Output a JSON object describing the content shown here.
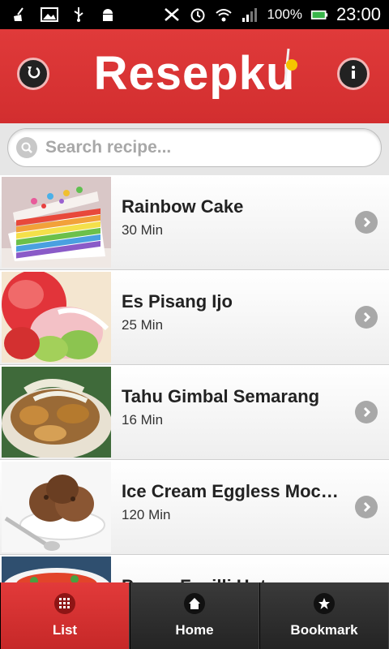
{
  "status_bar": {
    "battery": "100%",
    "time": "23:00",
    "icons": [
      "broom-icon",
      "image-icon",
      "usb-icon",
      "android-icon",
      "no-signal-icon",
      "alarm-icon",
      "wifi-icon",
      "signal-icon",
      "battery-icon"
    ]
  },
  "header": {
    "title": "Resepku",
    "left_button": "back-icon",
    "right_button": "info-icon"
  },
  "search": {
    "placeholder": "Search recipe...",
    "value": ""
  },
  "recipes": [
    {
      "name": "Rainbow Cake",
      "time": "30 Min"
    },
    {
      "name": "Es Pisang Ijo",
      "time": "25 Min"
    },
    {
      "name": "Tahu Gimbal Semarang",
      "time": "16 Min"
    },
    {
      "name": "Ice Cream Eggless Moc…",
      "time": "120 Min"
    },
    {
      "name": "Penne Fusilli Hot",
      "time": ""
    }
  ],
  "tabs": [
    {
      "label": "List",
      "icon": "grid-icon",
      "active": true
    },
    {
      "label": "Home",
      "icon": "home-icon",
      "active": false
    },
    {
      "label": "Bookmark",
      "icon": "star-icon",
      "active": false
    }
  ],
  "colors": {
    "header_red": "#d63031",
    "tab_active": "#d32f2f",
    "tab_inactive": "#2b2b2b"
  }
}
